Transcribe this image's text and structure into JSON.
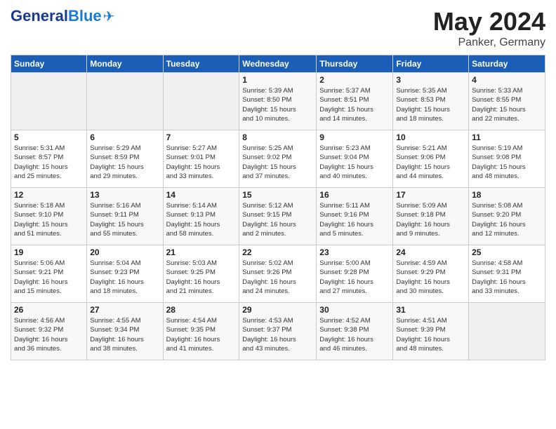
{
  "logo": {
    "general": "General",
    "blue": "Blue"
  },
  "title": "May 2024",
  "location": "Panker, Germany",
  "weekdays": [
    "Sunday",
    "Monday",
    "Tuesday",
    "Wednesday",
    "Thursday",
    "Friday",
    "Saturday"
  ],
  "weeks": [
    [
      {
        "day": "",
        "info": ""
      },
      {
        "day": "",
        "info": ""
      },
      {
        "day": "",
        "info": ""
      },
      {
        "day": "1",
        "info": "Sunrise: 5:39 AM\nSunset: 8:50 PM\nDaylight: 15 hours\nand 10 minutes."
      },
      {
        "day": "2",
        "info": "Sunrise: 5:37 AM\nSunset: 8:51 PM\nDaylight: 15 hours\nand 14 minutes."
      },
      {
        "day": "3",
        "info": "Sunrise: 5:35 AM\nSunset: 8:53 PM\nDaylight: 15 hours\nand 18 minutes."
      },
      {
        "day": "4",
        "info": "Sunrise: 5:33 AM\nSunset: 8:55 PM\nDaylight: 15 hours\nand 22 minutes."
      }
    ],
    [
      {
        "day": "5",
        "info": "Sunrise: 5:31 AM\nSunset: 8:57 PM\nDaylight: 15 hours\nand 25 minutes."
      },
      {
        "day": "6",
        "info": "Sunrise: 5:29 AM\nSunset: 8:59 PM\nDaylight: 15 hours\nand 29 minutes."
      },
      {
        "day": "7",
        "info": "Sunrise: 5:27 AM\nSunset: 9:01 PM\nDaylight: 15 hours\nand 33 minutes."
      },
      {
        "day": "8",
        "info": "Sunrise: 5:25 AM\nSunset: 9:02 PM\nDaylight: 15 hours\nand 37 minutes."
      },
      {
        "day": "9",
        "info": "Sunrise: 5:23 AM\nSunset: 9:04 PM\nDaylight: 15 hours\nand 40 minutes."
      },
      {
        "day": "10",
        "info": "Sunrise: 5:21 AM\nSunset: 9:06 PM\nDaylight: 15 hours\nand 44 minutes."
      },
      {
        "day": "11",
        "info": "Sunrise: 5:19 AM\nSunset: 9:08 PM\nDaylight: 15 hours\nand 48 minutes."
      }
    ],
    [
      {
        "day": "12",
        "info": "Sunrise: 5:18 AM\nSunset: 9:10 PM\nDaylight: 15 hours\nand 51 minutes."
      },
      {
        "day": "13",
        "info": "Sunrise: 5:16 AM\nSunset: 9:11 PM\nDaylight: 15 hours\nand 55 minutes."
      },
      {
        "day": "14",
        "info": "Sunrise: 5:14 AM\nSunset: 9:13 PM\nDaylight: 15 hours\nand 58 minutes."
      },
      {
        "day": "15",
        "info": "Sunrise: 5:12 AM\nSunset: 9:15 PM\nDaylight: 16 hours\nand 2 minutes."
      },
      {
        "day": "16",
        "info": "Sunrise: 5:11 AM\nSunset: 9:16 PM\nDaylight: 16 hours\nand 5 minutes."
      },
      {
        "day": "17",
        "info": "Sunrise: 5:09 AM\nSunset: 9:18 PM\nDaylight: 16 hours\nand 9 minutes."
      },
      {
        "day": "18",
        "info": "Sunrise: 5:08 AM\nSunset: 9:20 PM\nDaylight: 16 hours\nand 12 minutes."
      }
    ],
    [
      {
        "day": "19",
        "info": "Sunrise: 5:06 AM\nSunset: 9:21 PM\nDaylight: 16 hours\nand 15 minutes."
      },
      {
        "day": "20",
        "info": "Sunrise: 5:04 AM\nSunset: 9:23 PM\nDaylight: 16 hours\nand 18 minutes."
      },
      {
        "day": "21",
        "info": "Sunrise: 5:03 AM\nSunset: 9:25 PM\nDaylight: 16 hours\nand 21 minutes."
      },
      {
        "day": "22",
        "info": "Sunrise: 5:02 AM\nSunset: 9:26 PM\nDaylight: 16 hours\nand 24 minutes."
      },
      {
        "day": "23",
        "info": "Sunrise: 5:00 AM\nSunset: 9:28 PM\nDaylight: 16 hours\nand 27 minutes."
      },
      {
        "day": "24",
        "info": "Sunrise: 4:59 AM\nSunset: 9:29 PM\nDaylight: 16 hours\nand 30 minutes."
      },
      {
        "day": "25",
        "info": "Sunrise: 4:58 AM\nSunset: 9:31 PM\nDaylight: 16 hours\nand 33 minutes."
      }
    ],
    [
      {
        "day": "26",
        "info": "Sunrise: 4:56 AM\nSunset: 9:32 PM\nDaylight: 16 hours\nand 36 minutes."
      },
      {
        "day": "27",
        "info": "Sunrise: 4:55 AM\nSunset: 9:34 PM\nDaylight: 16 hours\nand 38 minutes."
      },
      {
        "day": "28",
        "info": "Sunrise: 4:54 AM\nSunset: 9:35 PM\nDaylight: 16 hours\nand 41 minutes."
      },
      {
        "day": "29",
        "info": "Sunrise: 4:53 AM\nSunset: 9:37 PM\nDaylight: 16 hours\nand 43 minutes."
      },
      {
        "day": "30",
        "info": "Sunrise: 4:52 AM\nSunset: 9:38 PM\nDaylight: 16 hours\nand 46 minutes."
      },
      {
        "day": "31",
        "info": "Sunrise: 4:51 AM\nSunset: 9:39 PM\nDaylight: 16 hours\nand 48 minutes."
      },
      {
        "day": "",
        "info": ""
      }
    ]
  ]
}
